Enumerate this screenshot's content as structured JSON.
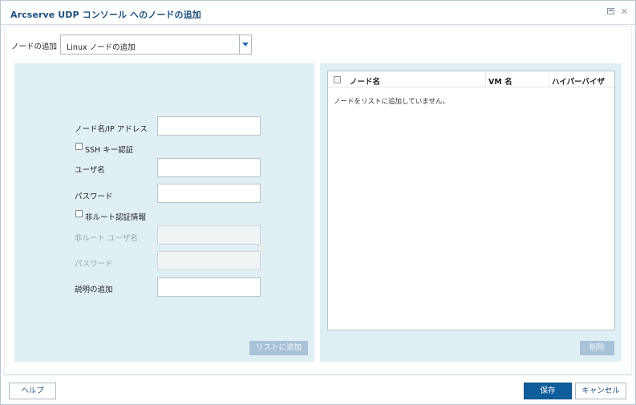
{
  "dialog": {
    "title": "Arcserve UDP コンソール へのノードの追加",
    "restore_icon": "restore-icon",
    "close_icon": "close-icon",
    "close_glyph": "✕"
  },
  "node_type": {
    "label": "ノードの追加",
    "selected": "Linux ノードの追加"
  },
  "form": {
    "node_name_label": "ノード名/IP アドレス",
    "ssh_key_label": "SSH キー認証",
    "username_label": "ユーザ名",
    "password_label": "パスワード",
    "non_root_label": "非ルート認証情報",
    "non_root_user_label": "非ルート ユーザ名",
    "non_root_password_label": "パスワード",
    "description_label": "説明の追加",
    "add_to_list_button": "リストに追加"
  },
  "node_list": {
    "columns": [
      "ノード名",
      "VM 名",
      "ハイパーバイザ"
    ],
    "empty_message": "ノードをリストに追加していません。",
    "delete_button": "削除"
  },
  "footer": {
    "help_button": "ヘルプ",
    "save_button": "保存",
    "cancel_button": "キャンセル"
  },
  "colors": {
    "title": "#1c4f7e",
    "panel_bg": "#e0eff3",
    "primary_button": "#0f5e9c",
    "disabled_button": "#a8c3d8"
  }
}
